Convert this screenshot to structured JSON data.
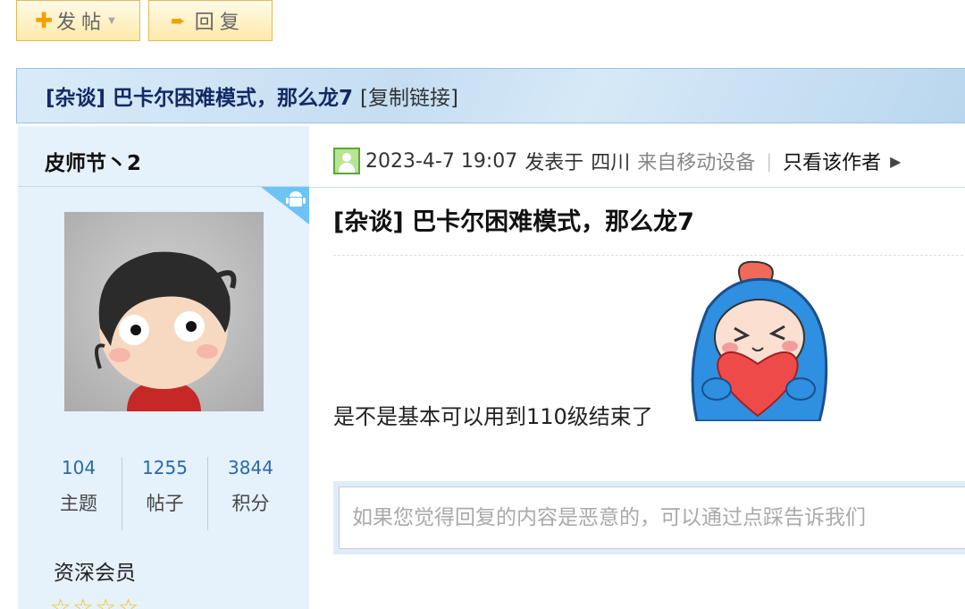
{
  "toolbar": {
    "post_label": "发帖",
    "reply_label": "回复"
  },
  "thread": {
    "title": "[杂谈] 巴卡尔困难模式，那么龙7",
    "copy_link": "[复制链接]"
  },
  "author": {
    "name": "皮师节丶2",
    "stats": [
      {
        "value": "104",
        "label": "主题"
      },
      {
        "value": "1255",
        "label": "帖子"
      },
      {
        "value": "3844",
        "label": "积分"
      }
    ],
    "level": "资深会员",
    "stars_glyph": "☆☆☆☆"
  },
  "post": {
    "datetime": "2023-4-7 19:07",
    "posted_at_label": "发表于",
    "location": "四川",
    "device": "来自移动设备",
    "divider": "|",
    "only_author": "只看该作者",
    "subject": "[杂谈] 巴卡尔困难模式，那么龙7",
    "body": "是不是基本可以用到110级结束了",
    "report_placeholder": "如果您觉得回复的内容是恶意的，可以通过点踩告诉我们"
  },
  "colors": {
    "title_text": "#142a66",
    "author_panel": "#e5f1fb",
    "stat_number": "#2a69a8",
    "button_border": "#e3b85a"
  },
  "icons": [
    "plus-icon",
    "arrow-right-icon",
    "chevron-down-icon",
    "android-icon",
    "user-icon",
    "triangle-right-icon",
    "star-icon"
  ]
}
